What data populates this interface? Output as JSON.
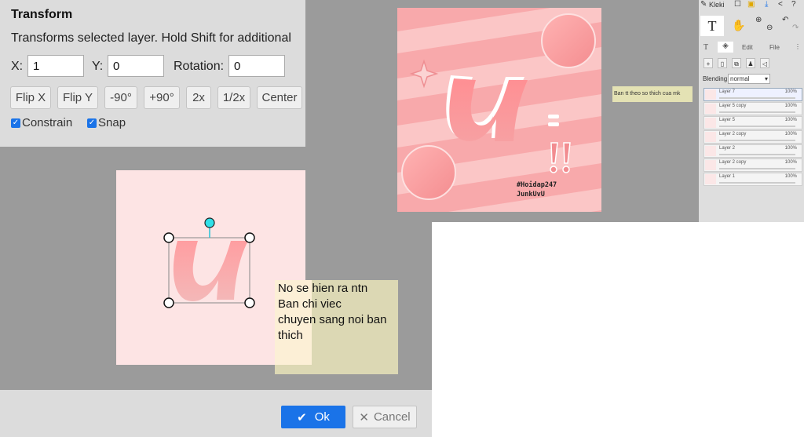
{
  "transform_dialog": {
    "title": "Transform",
    "description": "Transforms selected layer. Hold Shift for additional",
    "x_label": "X:",
    "x_value": "1",
    "y_label": "Y:",
    "y_value": "0",
    "rotation_label": "Rotation:",
    "rotation_value": "0",
    "buttons": {
      "flip_x": "Flip X",
      "flip_y": "Flip Y",
      "rot_neg90": "-90°",
      "rot_pos90": "+90°",
      "scale_2x": "2x",
      "scale_half": "1/2x",
      "center": "Center"
    },
    "constrain_label": "Constrain",
    "constrain_checked": true,
    "snap_label": "Snap",
    "snap_checked": true,
    "ok_label": "Ok",
    "cancel_label": "Cancel"
  },
  "preview_note": {
    "lines": [
      "No se hien ra ntn",
      "Ban chi viec",
      "chuyen sang noi ban",
      "thich"
    ]
  },
  "editor": {
    "note": "Ban tt theo so thich cua mk",
    "artwork_tag": "#Hoidap247",
    "artwork_signature": "JunkUvU",
    "artwork_letter": "u"
  },
  "side_panel": {
    "app_name": "Kleki",
    "tool_active": "T",
    "tabs": [
      "Edit",
      "File"
    ],
    "blending_label": "Blending",
    "blending_value": "normal",
    "layers": [
      {
        "name": "Layer 7",
        "opacity": "100%",
        "active": true
      },
      {
        "name": "Layer 5 copy",
        "opacity": "100%",
        "active": false
      },
      {
        "name": "Layer 5",
        "opacity": "100%",
        "active": false
      },
      {
        "name": "Layer 2 copy",
        "opacity": "100%",
        "active": false
      },
      {
        "name": "Layer 2",
        "opacity": "100%",
        "active": false
      },
      {
        "name": "Layer 2 copy",
        "opacity": "100%",
        "active": false
      },
      {
        "name": "Layer 1",
        "opacity": "100%",
        "active": false
      }
    ]
  },
  "colors": {
    "primary_button": "#1a73e8",
    "canvas_pink": "#f7a5a7",
    "note_yellow": "#dcd8b4"
  }
}
